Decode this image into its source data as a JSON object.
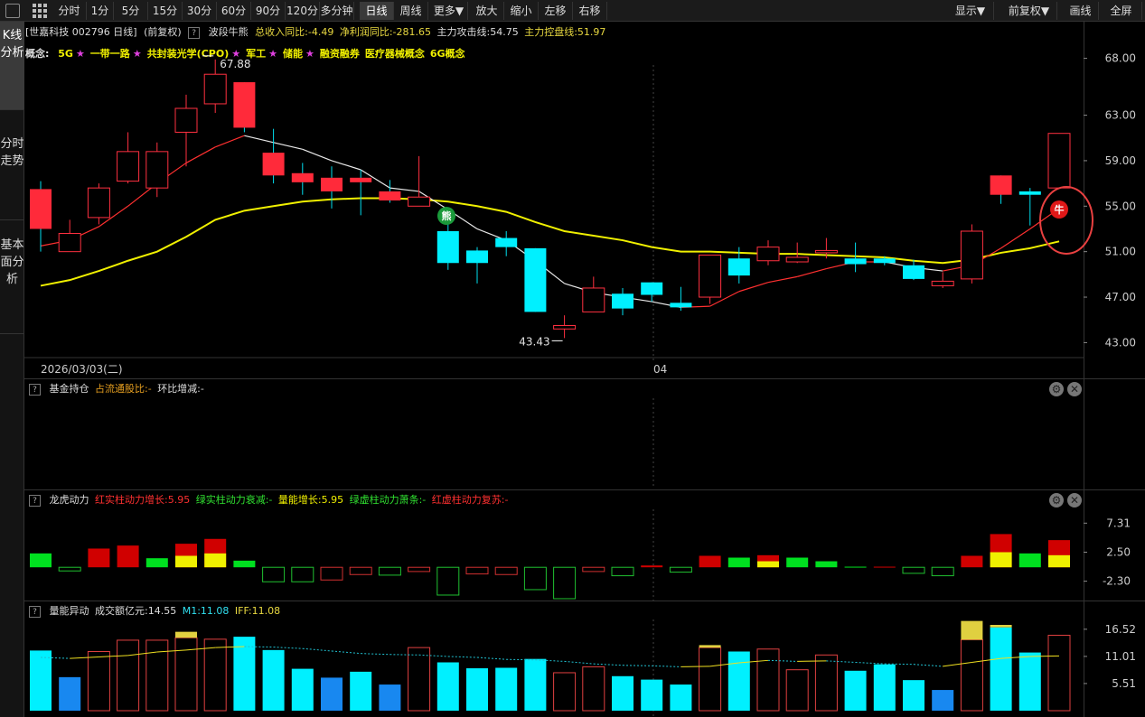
{
  "toolbar": {
    "periods": [
      "分时",
      "1分",
      "5分",
      "15分",
      "30分",
      "60分",
      "90分",
      "120分",
      "多分钟",
      "日线",
      "周线",
      "更多▼",
      "放大",
      "缩小",
      "左移",
      "右移"
    ],
    "active": "日线",
    "right": [
      "显示▼",
      "前复权▼",
      "画线",
      "全屏"
    ]
  },
  "sidetabs": [
    "K线分析",
    "分时走势",
    "基本面分析"
  ],
  "header": {
    "stock": "[世嘉科技 002796 日线]",
    "adjust": "(前复权)",
    "indicator": "波段牛熊",
    "revenue": "总收入同比:-4.49",
    "profit": "净利润同比:-281.65",
    "attack": "主力攻击线:54.75",
    "control": "主力控盘线:51.97"
  },
  "concepts": {
    "label": "概念:",
    "items": [
      {
        "name": "5G",
        "star": true
      },
      {
        "name": "一带一路",
        "star": true
      },
      {
        "name": "共封装光学(CPO)",
        "star": true
      },
      {
        "name": "军工",
        "star": true
      },
      {
        "name": "储能",
        "star": true
      },
      {
        "name": "融资融券",
        "star": false
      },
      {
        "name": "医疗器械概念",
        "star": false
      },
      {
        "name": "6G概念",
        "star": false
      }
    ]
  },
  "main_chart": {
    "yticks": [
      "68.00",
      "63.00",
      "59.00",
      "55.00",
      "51.00",
      "47.00",
      "43.00"
    ],
    "high_label": "67.88",
    "low_label": "43.43",
    "date_left": "2026/03/03(二)",
    "date_mid": "04",
    "bear_badge": "熊",
    "bull_badge": "牛"
  },
  "fund_panel": {
    "title": "基金持仓",
    "ratio": "占流通股比:-",
    "change": "环比增减:-"
  },
  "dragon_panel": {
    "title": "龙虎动力",
    "t1": "红实柱动力增长:5.95",
    "t2": "绿实柱动力衰减:-",
    "t3": "量能增长:5.95",
    "t4": "绿虚柱动力萧条:-",
    "t5": "红虚柱动力复苏:-",
    "yticks": [
      "7.31",
      "2.50",
      "-2.30"
    ]
  },
  "volume_panel": {
    "title": "量能异动",
    "amount": "成交额亿元:14.55",
    "m1": "M1:11.08",
    "iff": "IFF:11.08",
    "yticks": [
      "16.52",
      "11.01",
      "5.51"
    ]
  },
  "chart_data": [
    {
      "type": "candlestick",
      "ylim": [
        42,
        69
      ],
      "candles": [
        {
          "o": 56.5,
          "c": 53.0,
          "h": 57.2,
          "l": 51.0
        },
        {
          "o": 51.0,
          "c": 52.6,
          "h": 53.8,
          "l": 51.0
        },
        {
          "o": 54.0,
          "c": 56.6,
          "h": 57.0,
          "l": 53.4
        },
        {
          "o": 57.2,
          "c": 59.8,
          "h": 61.5,
          "l": 57.0
        },
        {
          "o": 56.6,
          "c": 59.8,
          "h": 60.6,
          "l": 55.8
        },
        {
          "o": 61.5,
          "c": 63.6,
          "h": 64.8,
          "l": 58.5
        },
        {
          "o": 64.0,
          "c": 66.6,
          "h": 67.9,
          "l": 63.2
        },
        {
          "o": 65.9,
          "c": 61.9,
          "h": 65.9,
          "l": 61.5
        },
        {
          "o": 59.7,
          "c": 57.7,
          "h": 61.8,
          "l": 57.0
        },
        {
          "o": 57.9,
          "c": 57.1,
          "h": 58.8,
          "l": 56.0
        },
        {
          "o": 57.5,
          "c": 56.3,
          "h": 58.5,
          "l": 54.8
        },
        {
          "o": 57.5,
          "c": 57.1,
          "h": 58.2,
          "l": 54.2
        },
        {
          "o": 56.3,
          "c": 55.5,
          "h": 57.3,
          "l": 55.3
        },
        {
          "o": 55.0,
          "c": 55.8,
          "h": 59.4,
          "l": 55.0
        },
        {
          "o": 52.8,
          "c": 50.0,
          "h": 53.8,
          "l": 49.4
        },
        {
          "o": 51.1,
          "c": 50.0,
          "h": 51.4,
          "l": 48.2
        },
        {
          "o": 52.2,
          "c": 51.4,
          "h": 52.8,
          "l": 50.6
        },
        {
          "o": 51.3,
          "c": 45.7,
          "h": 51.3,
          "l": 45.7
        },
        {
          "o": 44.2,
          "c": 44.5,
          "h": 45.4,
          "l": 43.4
        },
        {
          "o": 45.7,
          "c": 47.8,
          "h": 48.8,
          "l": 45.7
        },
        {
          "o": 47.3,
          "c": 46.0,
          "h": 47.8,
          "l": 45.4
        },
        {
          "o": 48.3,
          "c": 47.2,
          "h": 48.3,
          "l": 46.6
        },
        {
          "o": 46.5,
          "c": 46.1,
          "h": 47.9,
          "l": 45.8
        },
        {
          "o": 47.0,
          "c": 50.7,
          "h": 50.7,
          "l": 46.4
        },
        {
          "o": 50.4,
          "c": 48.9,
          "h": 51.4,
          "l": 48.2
        },
        {
          "o": 50.2,
          "c": 51.4,
          "h": 52.0,
          "l": 49.8
        },
        {
          "o": 50.1,
          "c": 50.5,
          "h": 51.8,
          "l": 50.0
        },
        {
          "o": 50.9,
          "c": 51.1,
          "h": 52.2,
          "l": 50.4
        },
        {
          "o": 50.4,
          "c": 49.9,
          "h": 51.8,
          "l": 49.2
        },
        {
          "o": 50.4,
          "c": 50.0,
          "h": 50.6,
          "l": 49.8
        },
        {
          "o": 49.8,
          "c": 48.6,
          "h": 50.3,
          "l": 48.5
        },
        {
          "o": 48.0,
          "c": 48.4,
          "h": 49.2,
          "l": 47.8
        },
        {
          "o": 48.6,
          "c": 52.8,
          "h": 53.4,
          "l": 48.2
        },
        {
          "o": 57.7,
          "c": 56.0,
          "h": 57.7,
          "l": 55.2
        },
        {
          "o": 56.3,
          "c": 56.0,
          "h": 56.6,
          "l": 53.3
        },
        {
          "o": 56.6,
          "c": 61.4,
          "h": 61.4,
          "l": 56.6
        }
      ],
      "ma_attack": [
        51.5,
        52.0,
        53.2,
        55.0,
        57.0,
        58.8,
        60.2,
        61.2,
        60.6,
        60.0,
        59.0,
        58.2,
        56.6,
        56.3,
        54.7,
        53.0,
        52.0,
        50.2,
        48.2,
        47.4,
        47.0,
        46.6,
        46.1,
        46.2,
        47.5,
        48.3,
        48.8,
        49.5,
        50.1,
        50.1,
        49.6,
        49.3,
        49.8,
        51.3,
        53.0,
        54.8
      ],
      "ma_control": [
        48.0,
        48.5,
        49.3,
        50.2,
        51.0,
        52.3,
        53.8,
        54.6,
        55.0,
        55.4,
        55.6,
        55.7,
        55.7,
        55.6,
        55.4,
        55.0,
        54.5,
        53.6,
        52.8,
        52.4,
        52.0,
        51.4,
        51.0,
        51.0,
        50.9,
        50.8,
        50.8,
        50.7,
        50.6,
        50.5,
        50.2,
        50.0,
        50.3,
        50.9,
        51.3,
        51.9
      ]
    },
    {
      "type": "bar",
      "name": "龙虎动力",
      "ylim": [
        -5.5,
        9.6
      ],
      "values": [
        2.3,
        -0.6,
        3.1,
        3.6,
        1.5,
        3.9,
        4.7,
        1.1,
        -2.4,
        -2.4,
        -2.1,
        -1.2,
        -1.3,
        -0.7,
        -4.6,
        -1.1,
        -1.2,
        -3.7,
        -5.2,
        -0.7,
        -1.4,
        0.3,
        -0.8,
        1.9,
        1.6,
        2.0,
        1.6,
        1.0,
        0.1,
        0.1,
        -1.0,
        -1.4,
        1.9,
        5.5,
        2.3,
        4.5
      ],
      "yellow": [
        0,
        0,
        0,
        0,
        0,
        1.9,
        2.3,
        0,
        0,
        0,
        0,
        0,
        0,
        0,
        0,
        0,
        0,
        0,
        0,
        0,
        0,
        0,
        0,
        0,
        0,
        1.0,
        0,
        0,
        0,
        0,
        0,
        0,
        0,
        2.5,
        0,
        2.0
      ],
      "kind": [
        "g",
        "ho",
        "r",
        "r",
        "g",
        "r",
        "r",
        "g",
        "go",
        "go",
        "ro",
        "ro",
        "go",
        "ro",
        "go",
        "ro",
        "ro",
        "go",
        "go",
        "ro",
        "go",
        "r",
        "go",
        "r",
        "g",
        "r",
        "g",
        "g",
        "g",
        "r",
        "go",
        "go",
        "r",
        "r",
        "g",
        "r"
      ]
    },
    {
      "type": "bar",
      "name": "量能异动",
      "ylim": [
        0,
        18.5
      ],
      "values": [
        12.2,
        6.8,
        12.0,
        14.3,
        14.3,
        14.8,
        14.5,
        15.0,
        12.3,
        8.5,
        6.7,
        7.9,
        5.3,
        12.8,
        9.8,
        8.6,
        8.7,
        10.5,
        7.7,
        8.9,
        7.0,
        6.3,
        5.3,
        12.8,
        12.0,
        12.5,
        8.3,
        11.3,
        8.1,
        9.4,
        6.2,
        4.2,
        14.4,
        16.9,
        11.8,
        15.3
      ],
      "yellow": [
        0,
        0,
        0,
        0,
        0,
        1.2,
        0,
        0,
        0,
        0,
        0,
        0,
        0,
        0,
        0,
        0,
        0,
        0,
        0,
        0,
        0,
        0,
        0,
        0.5,
        0,
        0,
        0,
        0,
        0,
        0,
        0,
        0,
        3.8,
        0.5,
        0,
        0
      ],
      "kind": [
        "c",
        "b",
        "ro",
        "ro",
        "ro",
        "ro",
        "ro",
        "c",
        "c",
        "c",
        "b",
        "c",
        "b",
        "ro",
        "c",
        "c",
        "c",
        "c",
        "ro",
        "ro",
        "c",
        "c",
        "c",
        "ro",
        "c",
        "ro",
        "ro",
        "ro",
        "c",
        "c",
        "c",
        "b",
        "ro",
        "c",
        "c",
        "ro"
      ],
      "ma": [
        10.8,
        10.6,
        10.9,
        11.2,
        11.9,
        12.3,
        12.8,
        13.0,
        12.9,
        12.6,
        12.1,
        11.6,
        11.4,
        11.3,
        11.0,
        10.8,
        10.4,
        10.3,
        10.0,
        9.5,
        9.2,
        9.1,
        8.9,
        9.0,
        9.7,
        10.2,
        10.0,
        10.1,
        9.8,
        9.5,
        9.4,
        9.0,
        9.8,
        10.6,
        11.0,
        11.1
      ]
    }
  ]
}
